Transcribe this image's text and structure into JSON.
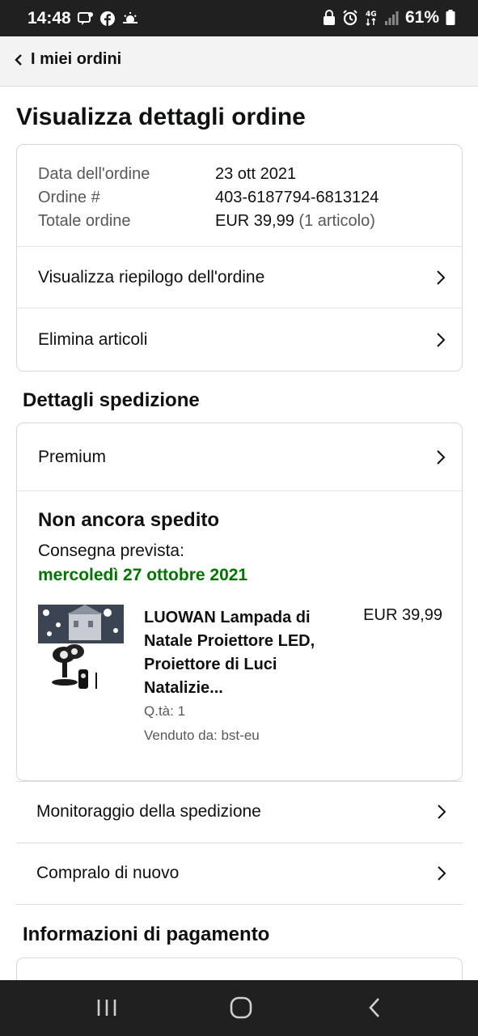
{
  "status_bar": {
    "time": "14:48",
    "battery": "61%",
    "network": "4G",
    "left_icons": [
      "notification-icon",
      "facebook-icon",
      "weather-icon"
    ],
    "right_icons": [
      "lock-icon",
      "alarm-icon",
      "network-4g-icon",
      "signal-icon",
      "battery-icon"
    ]
  },
  "header": {
    "back_label": "I miei ordini"
  },
  "page": {
    "title": "Visualizza dettagli ordine"
  },
  "order_summary": {
    "rows": [
      {
        "label": "Data dell'ordine",
        "value": "23 ott 2021"
      },
      {
        "label": "Ordine #",
        "value": "403-6187794-6813124"
      },
      {
        "label": "Totale ordine",
        "value": "EUR 39,99",
        "extra": "(1 articolo)"
      }
    ],
    "links": [
      {
        "label": "Visualizza riepilogo dell'ordine"
      },
      {
        "label": "Elimina articoli"
      }
    ]
  },
  "shipping": {
    "section_title": "Dettagli spedizione",
    "method": "Premium",
    "status": "Non ancora spedito",
    "delivery_label": "Consegna prevista:",
    "delivery_date": "mercoledì 27 ottobre 2021",
    "item": {
      "title": "LUOWAN Lampada di Natale Proiettore LED, Proiettore di Luci Natalizie...",
      "price": "EUR 39,99",
      "quantity": "Q.tà: 1",
      "seller": "Venduto da: bst-eu"
    },
    "actions": [
      {
        "label": "Monitoraggio della spedizione"
      },
      {
        "label": "Compralo di nuovo"
      }
    ]
  },
  "payment": {
    "section_title": "Informazioni di pagamento"
  },
  "colors": {
    "status_bar": "#202020",
    "header_bg": "#f3f3f3",
    "delivery_green": "#007600",
    "text": "#0f1111",
    "muted": "#565959",
    "border": "#d5d9d9"
  }
}
